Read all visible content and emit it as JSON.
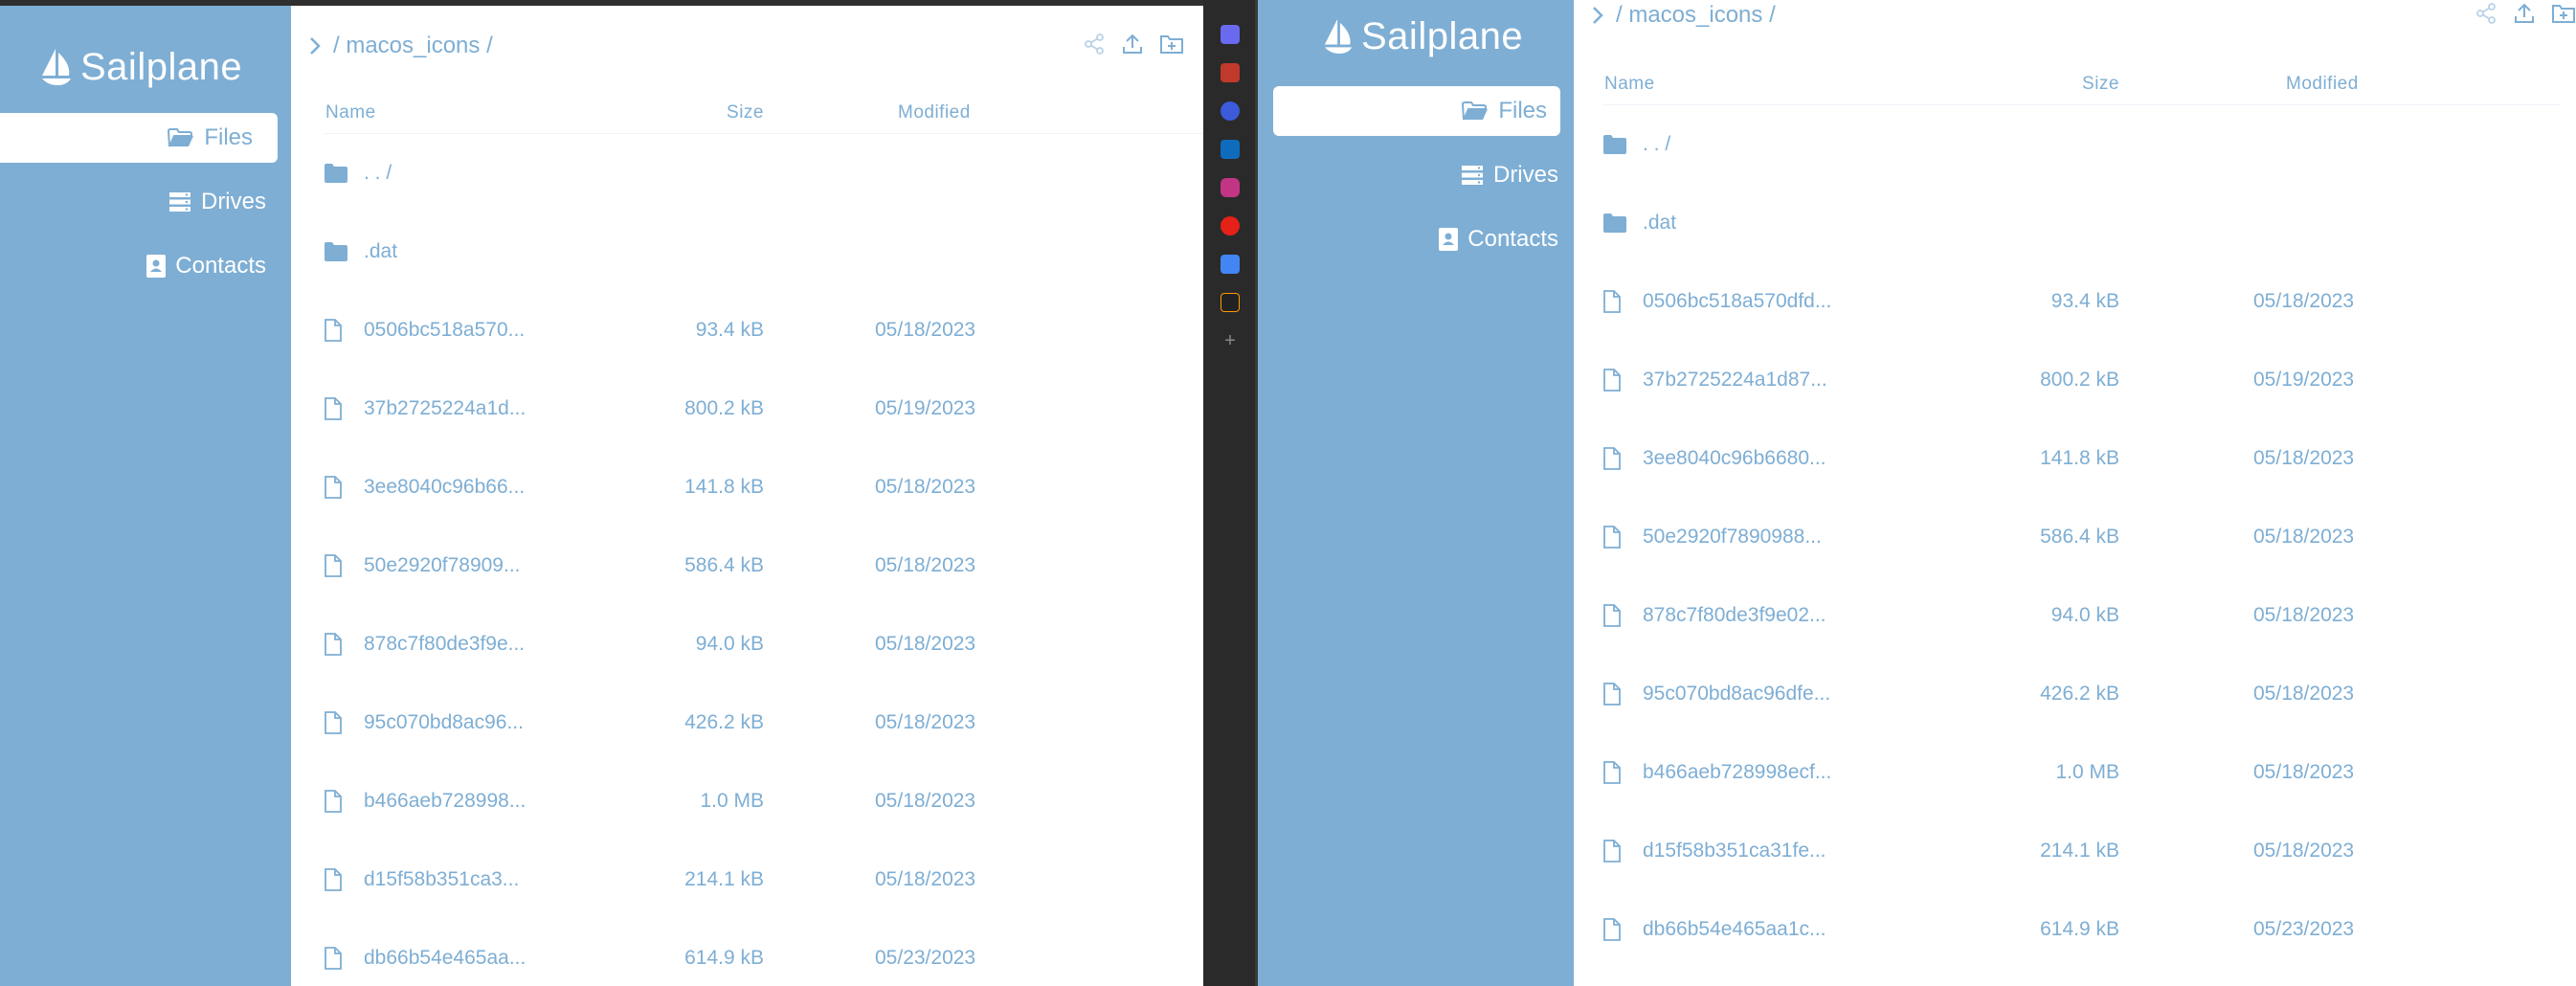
{
  "app_name": "Sailplane",
  "nav": [
    {
      "label": "Files",
      "icon": "folder-open-icon",
      "active": true
    },
    {
      "label": "Drives",
      "icon": "drives-icon",
      "active": false
    },
    {
      "label": "Contacts",
      "icon": "contact-card-icon",
      "active": false
    }
  ],
  "path": "/ macos_icons /",
  "toolbar": {
    "share_icon": "share-icon",
    "upload_icon": "upload-icon",
    "new_folder_icon": "new-folder-icon"
  },
  "columns": {
    "name": "Name",
    "size": "Size",
    "modified": "Modified"
  },
  "left_files": [
    {
      "name": ". . /",
      "type": "folder",
      "size": "",
      "modified": ""
    },
    {
      "name": ".dat",
      "type": "folder",
      "size": "",
      "modified": ""
    },
    {
      "name": "0506bc518a570...",
      "type": "file",
      "size": "93.4 kB",
      "modified": "05/18/2023"
    },
    {
      "name": "37b2725224a1d...",
      "type": "file",
      "size": "800.2 kB",
      "modified": "05/19/2023"
    },
    {
      "name": "3ee8040c96b66...",
      "type": "file",
      "size": "141.8 kB",
      "modified": "05/18/2023"
    },
    {
      "name": "50e2920f78909...",
      "type": "file",
      "size": "586.4 kB",
      "modified": "05/18/2023"
    },
    {
      "name": "878c7f80de3f9e...",
      "type": "file",
      "size": "94.0 kB",
      "modified": "05/18/2023"
    },
    {
      "name": "95c070bd8ac96...",
      "type": "file",
      "size": "426.2 kB",
      "modified": "05/18/2023"
    },
    {
      "name": "b466aeb728998...",
      "type": "file",
      "size": "1.0 MB",
      "modified": "05/18/2023"
    },
    {
      "name": "d15f58b351ca3...",
      "type": "file",
      "size": "214.1 kB",
      "modified": "05/18/2023"
    },
    {
      "name": "db66b54e465aa...",
      "type": "file",
      "size": "614.9 kB",
      "modified": "05/23/2023"
    }
  ],
  "right_files": [
    {
      "name": ". . /",
      "type": "folder",
      "size": "",
      "modified": ""
    },
    {
      "name": ".dat",
      "type": "folder",
      "size": "",
      "modified": ""
    },
    {
      "name": "0506bc518a570dfd...",
      "type": "file",
      "size": "93.4 kB",
      "modified": "05/18/2023"
    },
    {
      "name": "37b2725224a1d87...",
      "type": "file",
      "size": "800.2 kB",
      "modified": "05/19/2023"
    },
    {
      "name": "3ee8040c96b6680...",
      "type": "file",
      "size": "141.8 kB",
      "modified": "05/18/2023"
    },
    {
      "name": "50e2920f7890988...",
      "type": "file",
      "size": "586.4 kB",
      "modified": "05/18/2023"
    },
    {
      "name": "878c7f80de3f9e02...",
      "type": "file",
      "size": "94.0 kB",
      "modified": "05/18/2023"
    },
    {
      "name": "95c070bd8ac96dfe...",
      "type": "file",
      "size": "426.2 kB",
      "modified": "05/18/2023"
    },
    {
      "name": "b466aeb728998ecf...",
      "type": "file",
      "size": "1.0 MB",
      "modified": "05/18/2023"
    },
    {
      "name": "d15f58b351ca31fe...",
      "type": "file",
      "size": "214.1 kB",
      "modified": "05/18/2023"
    },
    {
      "name": "db66b54e465aa1c...",
      "type": "file",
      "size": "614.9 kB",
      "modified": "05/23/2023"
    }
  ],
  "dock_icons": [
    "tag-icon",
    "toolbox-icon",
    "copilot-icon",
    "outlook-icon",
    "instagram-icon",
    "youtube-icon",
    "docs-icon",
    "amazon-icon",
    "add-icon"
  ],
  "colors": {
    "sidebar": "#7eaed4",
    "accent": "#7eaed4",
    "background": "#ffffff"
  }
}
